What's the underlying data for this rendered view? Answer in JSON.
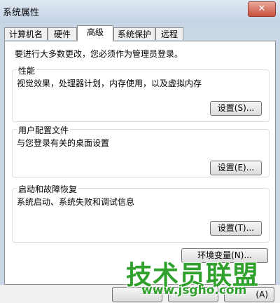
{
  "window": {
    "title": "系统属性",
    "close_glyph": "✕"
  },
  "tabs": [
    {
      "label": "计算机名"
    },
    {
      "label": "硬件"
    },
    {
      "label": "高级"
    },
    {
      "label": "系统保护"
    },
    {
      "label": "远程"
    }
  ],
  "active_tab": "高级",
  "admin_note": "要进行大多数更改，您必须作为管理员登录。",
  "groups": {
    "performance": {
      "title": "性能",
      "description": "视觉效果，处理器计划，内存使用，以及虚拟内存",
      "button": "设置(S)..."
    },
    "profiles": {
      "title": "用户配置文件",
      "description": "与您登录有关的桌面设置",
      "button": "设置(E)..."
    },
    "startup": {
      "title": "启动和故障恢复",
      "description": "系统启动、系统失败和调试信息",
      "button": "设置(T)..."
    }
  },
  "env_button": "环境变量(N)...",
  "footer": {
    "ok_label": "",
    "cancel_label": "",
    "apply_label": "(A)"
  },
  "watermark": {
    "main": "技术员联盟",
    "url": "www.jsgho.com"
  },
  "colors": {
    "watermark_green": "#2fa12c",
    "close_red": "#c8503c"
  }
}
